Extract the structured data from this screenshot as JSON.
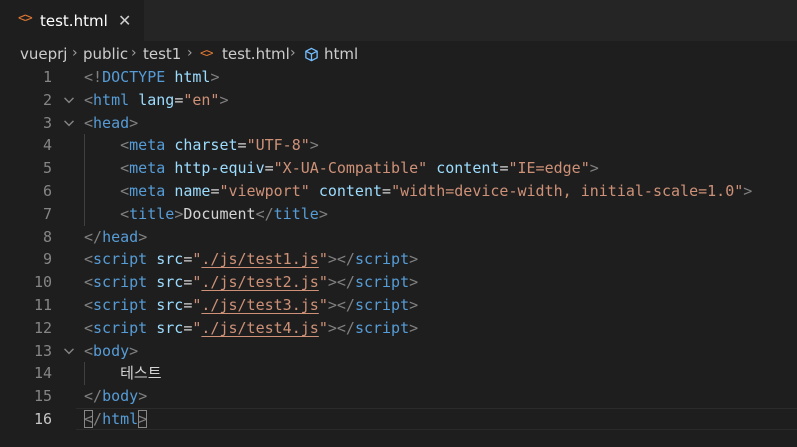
{
  "tab": {
    "icon": "code-brackets-icon",
    "label": "test.html",
    "close": "✕"
  },
  "breadcrumb": {
    "items": [
      "vueprj",
      "public",
      "test1",
      "test.html",
      "html"
    ],
    "separator": "›"
  },
  "editor": {
    "active_line": "16",
    "line_numbers": [
      "1",
      "2",
      "3",
      "4",
      "5",
      "6",
      "7",
      "8",
      "9",
      "10",
      "11",
      "12",
      "13",
      "14",
      "15",
      "16"
    ],
    "lines": [
      [
        [
          "br",
          "<!"
        ],
        [
          "tag",
          "DOCTYPE "
        ],
        [
          "attr",
          "html"
        ],
        [
          "br",
          ">"
        ]
      ],
      [
        [
          "br",
          "<"
        ],
        [
          "tag",
          "html "
        ],
        [
          "attr",
          "lang"
        ],
        [
          "eq",
          "="
        ],
        [
          "str",
          "\"en\""
        ],
        [
          "br",
          ">"
        ]
      ],
      [
        [
          "br",
          "<"
        ],
        [
          "tag",
          "head"
        ],
        [
          "br",
          ">"
        ]
      ],
      [
        [
          "txt",
          "    "
        ],
        [
          "br",
          "<"
        ],
        [
          "tag",
          "meta "
        ],
        [
          "attr",
          "charset"
        ],
        [
          "eq",
          "="
        ],
        [
          "str",
          "\"UTF-8\""
        ],
        [
          "br",
          ">"
        ]
      ],
      [
        [
          "txt",
          "    "
        ],
        [
          "br",
          "<"
        ],
        [
          "tag",
          "meta "
        ],
        [
          "attr",
          "http-equiv"
        ],
        [
          "eq",
          "="
        ],
        [
          "str",
          "\"X-UA-Compatible\" "
        ],
        [
          "attr",
          "content"
        ],
        [
          "eq",
          "="
        ],
        [
          "str",
          "\"IE=edge\""
        ],
        [
          "br",
          ">"
        ]
      ],
      [
        [
          "txt",
          "    "
        ],
        [
          "br",
          "<"
        ],
        [
          "tag",
          "meta "
        ],
        [
          "attr",
          "name"
        ],
        [
          "eq",
          "="
        ],
        [
          "str",
          "\"viewport\" "
        ],
        [
          "attr",
          "content"
        ],
        [
          "eq",
          "="
        ],
        [
          "str",
          "\"width=device-width, initial-scale=1.0\""
        ],
        [
          "br",
          ">"
        ]
      ],
      [
        [
          "txt",
          "    "
        ],
        [
          "br",
          "<"
        ],
        [
          "tag",
          "title"
        ],
        [
          "br",
          ">"
        ],
        [
          "txt",
          "Document"
        ],
        [
          "br",
          "</"
        ],
        [
          "tag",
          "title"
        ],
        [
          "br",
          ">"
        ]
      ],
      [
        [
          "br",
          "</"
        ],
        [
          "tag",
          "head"
        ],
        [
          "br",
          ">"
        ]
      ],
      [
        [
          "br",
          "<"
        ],
        [
          "tag",
          "script "
        ],
        [
          "attr",
          "src"
        ],
        [
          "eq",
          "="
        ],
        [
          "str",
          "\""
        ],
        [
          "link",
          "./js/test1.js"
        ],
        [
          "str",
          "\""
        ],
        [
          "br",
          "></"
        ],
        [
          "tag",
          "script"
        ],
        [
          "br",
          ">"
        ]
      ],
      [
        [
          "br",
          "<"
        ],
        [
          "tag",
          "script "
        ],
        [
          "attr",
          "src"
        ],
        [
          "eq",
          "="
        ],
        [
          "str",
          "\""
        ],
        [
          "link",
          "./js/test2.js"
        ],
        [
          "str",
          "\""
        ],
        [
          "br",
          "></"
        ],
        [
          "tag",
          "script"
        ],
        [
          "br",
          ">"
        ]
      ],
      [
        [
          "br",
          "<"
        ],
        [
          "tag",
          "script "
        ],
        [
          "attr",
          "src"
        ],
        [
          "eq",
          "="
        ],
        [
          "str",
          "\""
        ],
        [
          "link",
          "./js/test3.js"
        ],
        [
          "str",
          "\""
        ],
        [
          "br",
          "></"
        ],
        [
          "tag",
          "script"
        ],
        [
          "br",
          ">"
        ]
      ],
      [
        [
          "br",
          "<"
        ],
        [
          "tag",
          "script "
        ],
        [
          "attr",
          "src"
        ],
        [
          "eq",
          "="
        ],
        [
          "str",
          "\""
        ],
        [
          "link",
          "./js/test4.js"
        ],
        [
          "str",
          "\""
        ],
        [
          "br",
          "></"
        ],
        [
          "tag",
          "script"
        ],
        [
          "br",
          ">"
        ]
      ],
      [
        [
          "br",
          "<"
        ],
        [
          "tag",
          "body"
        ],
        [
          "br",
          ">"
        ]
      ],
      [
        [
          "txt",
          "    테스트"
        ]
      ],
      [
        [
          "br",
          "</"
        ],
        [
          "tag",
          "body"
        ],
        [
          "br",
          ">"
        ]
      ],
      [
        [
          "bm",
          "<"
        ],
        [
          "br",
          "/"
        ],
        [
          "tag",
          "html"
        ],
        [
          "bm",
          ">"
        ]
      ]
    ],
    "foldable_lines": [
      "2",
      "3",
      "13"
    ]
  },
  "colors": {
    "background": "#1e1e1e",
    "tabbar": "#252526",
    "tag": "#569cd6",
    "attribute": "#9cdcfe",
    "string": "#ce9178",
    "bracket": "#808080",
    "html_icon": "#e37933",
    "symbol_icon": "#75beff"
  }
}
